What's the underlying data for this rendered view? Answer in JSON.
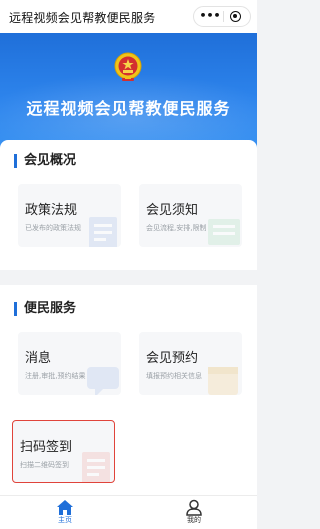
{
  "app_title": "远程视频会见帮教便民服务",
  "capsule": {
    "more_label": "•••"
  },
  "banner": {
    "headline": "远程视频会见帮教便民服务"
  },
  "sections": [
    {
      "title": "会见概况",
      "cards": [
        {
          "title": "政策法规",
          "subtitle": "已发布的政策法规"
        },
        {
          "title": "会见须知",
          "subtitle": "会见流程,安排,限制"
        }
      ]
    },
    {
      "title": "便民服务",
      "cards": [
        {
          "title": "消息",
          "subtitle": "注册,审批,预约结果"
        },
        {
          "title": "会见预约",
          "subtitle": "填报预约相关信息"
        },
        {
          "title": "扫码签到",
          "subtitle": "扫描二维码签到"
        }
      ]
    }
  ],
  "tabbar": {
    "items": [
      {
        "label": "主页",
        "icon": "home-icon",
        "active": true
      },
      {
        "label": "我的",
        "icon": "user-icon",
        "active": false
      }
    ]
  },
  "colors": {
    "primary": "#1f6fd9",
    "highlight_border": "#e0443b"
  }
}
